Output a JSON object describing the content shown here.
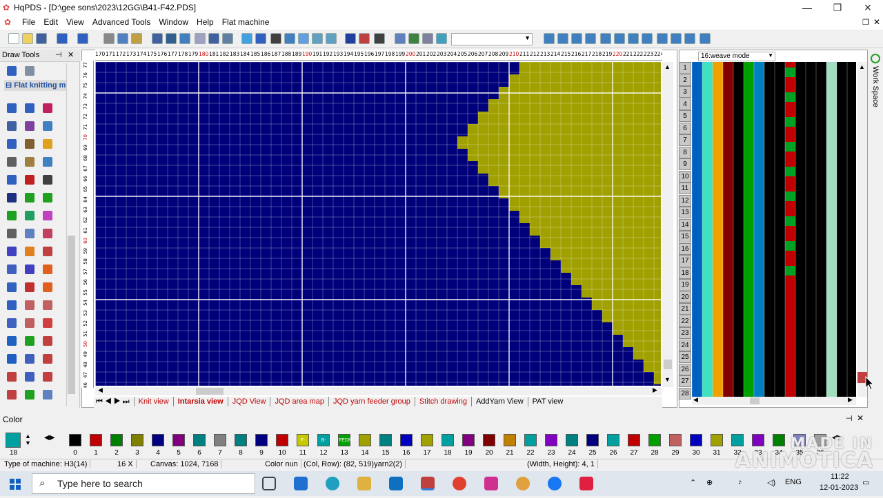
{
  "window": {
    "title": "HqPDS - [D:\\gee sons\\2023\\12GG\\B41-F42.PDS]",
    "minimize": "—",
    "restore": "❐",
    "close": "✕"
  },
  "menu": [
    "File",
    "Edit",
    "View",
    "Advanced Tools",
    "Window",
    "Help",
    "Flat machine"
  ],
  "drawtools": {
    "title": "Draw Tools",
    "group": "Flat knitting m"
  },
  "ruler": {
    "top_labels": [
      "170",
      "171",
      "172",
      "173",
      "174",
      "175",
      "176",
      "177",
      "178",
      "179",
      "180",
      "181",
      "182",
      "183",
      "184",
      "185",
      "186",
      "187",
      "188",
      "189",
      "190",
      "191",
      "192",
      "193",
      "194",
      "195",
      "196",
      "197",
      "198",
      "199",
      "200",
      "201",
      "202",
      "203",
      "204",
      "205",
      "206",
      "207",
      "208",
      "209",
      "210",
      "211",
      "212",
      "213",
      "214",
      "215",
      "216",
      "217",
      "218",
      "219",
      "220",
      "221",
      "222",
      "223",
      "224"
    ],
    "left_labels": [
      "77",
      "76",
      "75",
      "74",
      "73",
      "72",
      "71",
      "70",
      "69",
      "68",
      "67",
      "66",
      "65",
      "64",
      "63",
      "62",
      "61",
      "60",
      "59",
      "58",
      "57",
      "56",
      "55",
      "54",
      "53",
      "52",
      "51",
      "50",
      "49",
      "48",
      "47",
      "46"
    ]
  },
  "tabs": [
    "Knit view",
    "Intarsia view",
    "JQD View",
    "JQD area map",
    "JQD yarn feeder group",
    "Stitch drawing",
    "AddYarn View",
    "PAT view"
  ],
  "active_tab": "Intarsia view",
  "rightpanel": {
    "mode": "16:weave mode",
    "rows": [
      "1",
      "2",
      "3",
      "4",
      "5",
      "6",
      "7",
      "8",
      "9",
      "10",
      "11",
      "12",
      "13",
      "14",
      "15",
      "16",
      "17",
      "18",
      "19",
      "20",
      "21",
      "22",
      "23",
      "24",
      "25",
      "26",
      "27",
      "28"
    ],
    "workspace_label": "Work Space"
  },
  "colors": {
    "title": "Color",
    "current": "18",
    "indices": [
      "0",
      "1",
      "2",
      "3",
      "4",
      "5",
      "6",
      "7",
      "8",
      "9",
      "10",
      "11",
      "12",
      "13",
      "14",
      "15",
      "16",
      "17",
      "18",
      "19",
      "20",
      "21",
      "22",
      "23",
      "24",
      "25",
      "26",
      "27",
      "28",
      "29",
      "30",
      "31",
      "32",
      "33",
      "34",
      "35",
      "36"
    ],
    "swatch_labels": [
      "",
      "",
      "",
      "",
      "",
      "",
      "",
      "",
      "",
      "",
      "",
      "F-2ND",
      "B-2ND",
      "FEDN",
      "",
      "",
      "",
      "",
      "",
      "",
      "",
      "",
      "",
      "",
      "",
      "",
      "",
      "",
      "",
      "",
      "",
      "",
      "",
      "",
      "",
      "",
      ""
    ],
    "swatch_colors": [
      "#000000",
      "#c00000",
      "#008000",
      "#808000",
      "#000080",
      "#800080",
      "#008080",
      "#808080",
      "#008080",
      "#000080",
      "#c00000",
      "#c8c800",
      "#00a0a0",
      "#00a000",
      "#a0a000",
      "#008080",
      "#0000c0",
      "#a0a000",
      "#00a0a0",
      "#800080",
      "#800000",
      "#c08000",
      "#00a0a0",
      "#8000c0",
      "#008080",
      "#000080",
      "#00a0a0",
      "#c00000",
      "#00a000",
      "#c06060",
      "#0000c0",
      "#a0a000",
      "#00a0a0",
      "#8000c0",
      "#008000",
      "#8080c0",
      "#a0a0a0"
    ]
  },
  "status": {
    "machine": "Type of machine: H3(14)",
    "zoom": "16 X",
    "canvas": "Canvas: 1024, 7168",
    "color_num": "Color nun",
    "colrow": "(Col, Row): (82, 519)yarn2(2)",
    "wh": "(Width, Height): 4, 1"
  },
  "taskbar": {
    "search_placeholder": "Type here to search",
    "lang": "ENG",
    "time": "11:22",
    "date": "12-01-2023"
  },
  "watermark": {
    "line1": "MADE IN",
    "line2": "ANIMOTICA"
  },
  "pattern": {
    "background": "#00007a",
    "fill": "#a0a000",
    "grid_color": "#ffffff",
    "boundary_cols": [
      41,
      40,
      39,
      38,
      37,
      36,
      35,
      36,
      37,
      38,
      39,
      40,
      41,
      42,
      43,
      44,
      45,
      46,
      47,
      48,
      49,
      50,
      51,
      52,
      53,
      54
    ]
  },
  "yarn_stripes": [
    "#0060c0",
    "#40e0c0",
    "#f0a000",
    "#800000",
    "#000000",
    "#00a000",
    "#0080c0",
    "#000000",
    "#000000",
    "#c00000",
    "#000000",
    "#000000",
    "#000000",
    "#a0e0c0",
    "#000000",
    "#000000"
  ]
}
